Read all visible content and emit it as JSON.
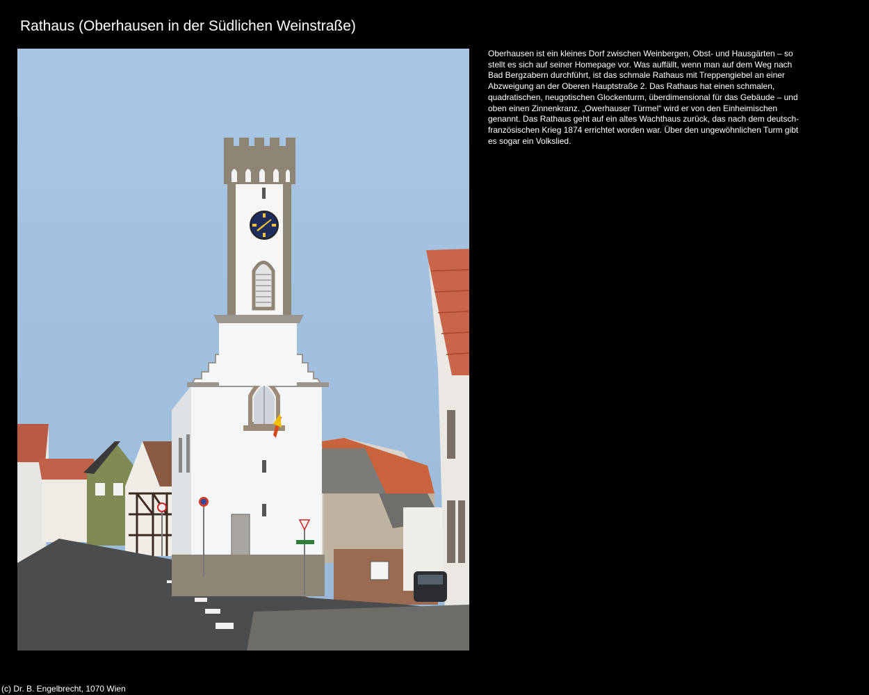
{
  "page": {
    "title": "Rathaus (Oberhausen in der Südlichen Weinstraße)",
    "description": "Oberhausen ist ein kleines Dorf zwischen Weinbergen, Obst- und Hausgärten – so stellt es sich auf seiner Homepage vor. Was auffällt, wenn man auf dem Weg nach Bad Bergzabern durchführt, ist das schmale Rathaus mit Treppengiebel an einer Abzweigung an der Oberen Hauptstraße 2. Das Rathaus hat einen schmalen, quadratischen, neugotischen Glockenturm, überdimensional für das Gebäude – und oben einen Zinnenkranz. „Owerhauser Türmel“ wird er von den Einheimischen genannt. Das Rathaus geht auf ein altes Wachthaus zurück, das nach dem deutsch-französischen Krieg 1874 errichtet worden war. Über den ungewöhnlichen Turm gibt es sogar ein Volkslied.",
    "footer": "(c) Dr. B. Engelbrecht, 1070 Wien"
  },
  "colors": {
    "background": "#000000",
    "text": "#ffffff",
    "sky": "#9fc0e0",
    "tower_white": "#f4f6f8",
    "sandstone": "#8f8577",
    "roof_red": "#c8563c",
    "asphalt": "#4a4c4e"
  }
}
